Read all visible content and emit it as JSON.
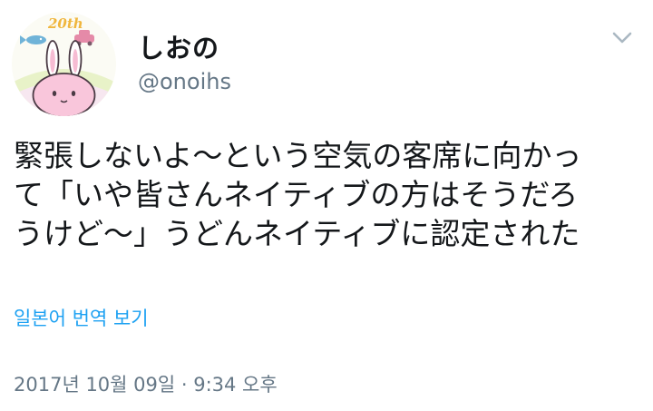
{
  "user": {
    "display_name": "しおの",
    "handle": "@onoihs",
    "avatar_badge": "20th",
    "avatar_icon": "bunny-avatar"
  },
  "menu": {
    "icon": "chevron-down-icon"
  },
  "tweet": {
    "lines": [
      "緊張しないよ〜という空気の客席に向かっ",
      "て「いや皆さんネイティブの方はそうだろ",
      "うけど〜」うどんネイティブに認定された"
    ],
    "translate_label": "일본어 번역 보기",
    "timestamp": "2017년 10월 09일 · 9:34 오후"
  },
  "colors": {
    "text": "#14171a",
    "secondary": "#657786",
    "link": "#1da1f2",
    "chevron": "#aab8c2"
  }
}
